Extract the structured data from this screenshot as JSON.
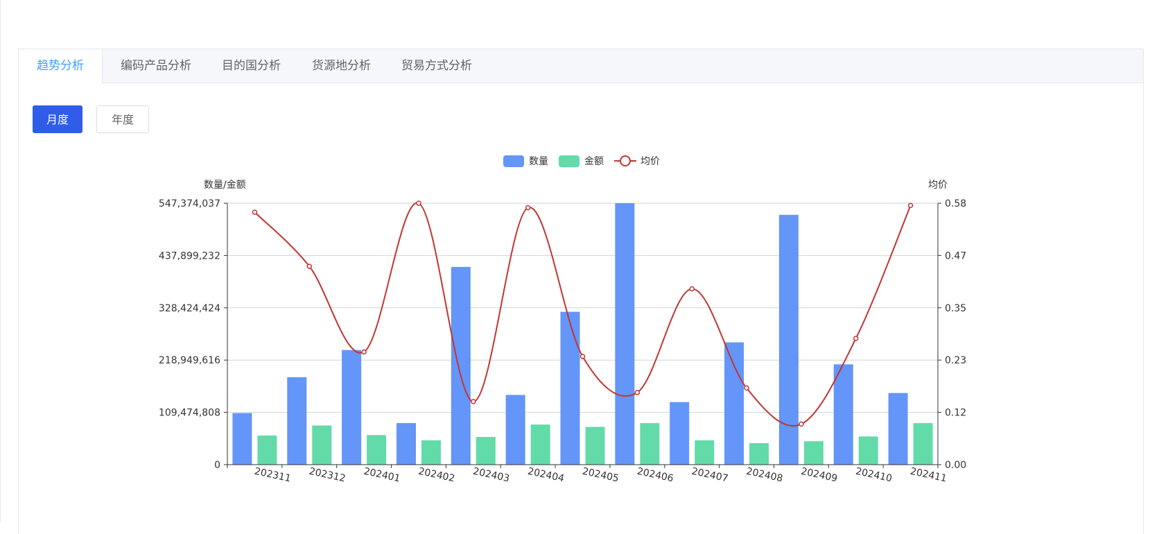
{
  "tabs": [
    {
      "label": "趋势分析",
      "active": true
    },
    {
      "label": "编码产品分析",
      "active": false
    },
    {
      "label": "目的国分析",
      "active": false
    },
    {
      "label": "货源地分析",
      "active": false
    },
    {
      "label": "贸易方式分析",
      "active": false
    }
  ],
  "period_toggle": {
    "monthly_label": "月度",
    "yearly_label": "年度",
    "selected": "月度"
  },
  "colors": {
    "accent": "#409eff",
    "primary_button": "#2f5ce9",
    "quantity_bar": "#6495f8",
    "amount_bar": "#62dba9",
    "price_line": "#c23531"
  },
  "chart_data": {
    "type": "bar",
    "categories": [
      "202311",
      "202312",
      "202401",
      "202402",
      "202403",
      "202404",
      "202405",
      "202406",
      "202407",
      "202408",
      "202409",
      "202410",
      "202411"
    ],
    "series": [
      {
        "name": "数量",
        "type": "bar",
        "axis": "left",
        "values": [
          108000000,
          183000000,
          240000000,
          87000000,
          414000000,
          146000000,
          320000000,
          547374037,
          131000000,
          256000000,
          523000000,
          210000000,
          150000000
        ]
      },
      {
        "name": "金额",
        "type": "bar",
        "axis": "left",
        "values": [
          61000000,
          82000000,
          62000000,
          51000000,
          58000000,
          84000000,
          79000000,
          87000000,
          51000000,
          45000000,
          49000000,
          59000000,
          87000000
        ]
      },
      {
        "name": "均价",
        "type": "line",
        "axis": "right",
        "smooth": true,
        "values": [
          0.56,
          0.44,
          0.25,
          0.58,
          0.14,
          0.57,
          0.24,
          0.16,
          0.39,
          0.17,
          0.09,
          0.28,
          0.575
        ]
      }
    ],
    "y_left": {
      "label": "数量/金额",
      "ticks": [
        "0",
        "109,474,808",
        "218,949,616",
        "328,424,424",
        "437,899,232",
        "547,374,037"
      ],
      "range": [
        0,
        547374037
      ]
    },
    "y_right": {
      "label": "均价",
      "ticks": [
        "0.00",
        "0.12",
        "0.23",
        "0.35",
        "0.47",
        "0.58"
      ],
      "range": [
        0,
        0.58
      ]
    },
    "legend_position": "top-center",
    "grid": true
  }
}
